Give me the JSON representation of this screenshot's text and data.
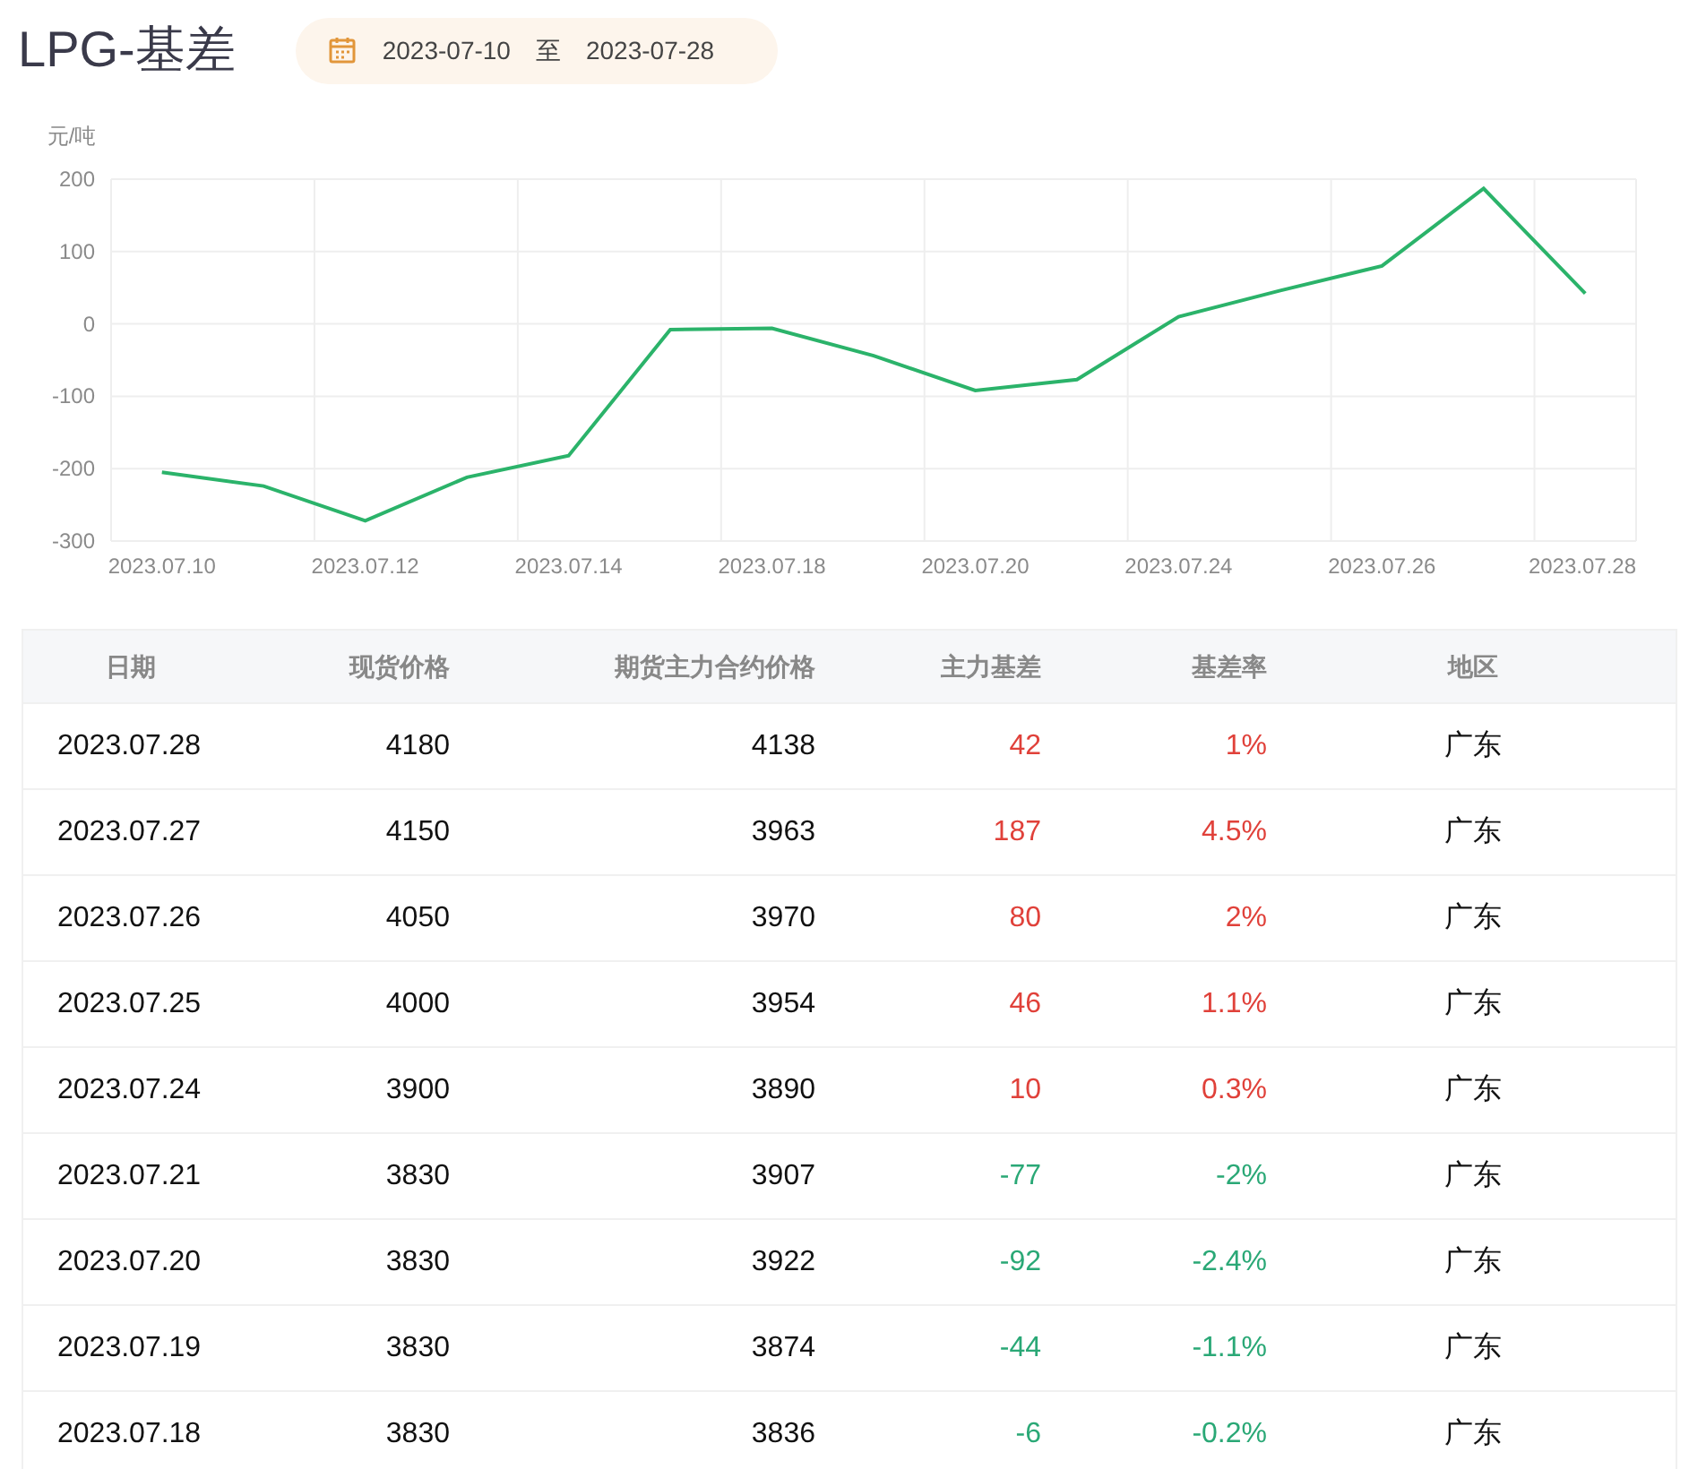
{
  "title": "LPG-基差",
  "date_range": {
    "start": "2023-07-10",
    "separator": "至",
    "end": "2023-07-28"
  },
  "chart_data": {
    "type": "line",
    "ylabel": "元/吨",
    "categories": [
      "2023.07.10",
      null,
      "2023.07.12",
      null,
      "2023.07.14",
      null,
      "2023.07.18",
      null,
      "2023.07.20",
      null,
      "2023.07.24",
      null,
      "2023.07.26",
      null,
      "2023.07.28"
    ],
    "grid": true,
    "ylim": [
      -300,
      200
    ],
    "yticks": [
      200,
      100,
      0,
      -100,
      -200,
      -300
    ],
    "series": [
      {
        "color": "#2bb36a",
        "values": [
          -205,
          -224,
          -272,
          -212,
          -182,
          -8,
          -6,
          -44,
          -92,
          -77,
          10,
          46,
          80,
          187,
          42
        ]
      }
    ]
  },
  "table": {
    "columns": [
      "日期",
      "现货价格",
      "期货主力合约价格",
      "主力基差",
      "基差率",
      "地区"
    ],
    "rows": [
      {
        "date": "2023.07.28",
        "spot": "4180",
        "futures": "4138",
        "basis": "42",
        "rate": "1%",
        "region": "广东",
        "color": "#e0413a"
      },
      {
        "date": "2023.07.27",
        "spot": "4150",
        "futures": "3963",
        "basis": "187",
        "rate": "4.5%",
        "region": "广东",
        "color": "#e0413a"
      },
      {
        "date": "2023.07.26",
        "spot": "4050",
        "futures": "3970",
        "basis": "80",
        "rate": "2%",
        "region": "广东",
        "color": "#e0413a"
      },
      {
        "date": "2023.07.25",
        "spot": "4000",
        "futures": "3954",
        "basis": "46",
        "rate": "1.1%",
        "region": "广东",
        "color": "#e0413a"
      },
      {
        "date": "2023.07.24",
        "spot": "3900",
        "futures": "3890",
        "basis": "10",
        "rate": "0.3%",
        "region": "广东",
        "color": "#e0413a"
      },
      {
        "date": "2023.07.21",
        "spot": "3830",
        "futures": "3907",
        "basis": "-77",
        "rate": "-2%",
        "region": "广东",
        "color": "#2aa876"
      },
      {
        "date": "2023.07.20",
        "spot": "3830",
        "futures": "3922",
        "basis": "-92",
        "rate": "-2.4%",
        "region": "广东",
        "color": "#2aa876"
      },
      {
        "date": "2023.07.19",
        "spot": "3830",
        "futures": "3874",
        "basis": "-44",
        "rate": "-1.1%",
        "region": "广东",
        "color": "#2aa876"
      },
      {
        "date": "2023.07.18",
        "spot": "3830",
        "futures": "3836",
        "basis": "-6",
        "rate": "-0.2%",
        "region": "广东",
        "color": "#2aa876"
      }
    ]
  }
}
